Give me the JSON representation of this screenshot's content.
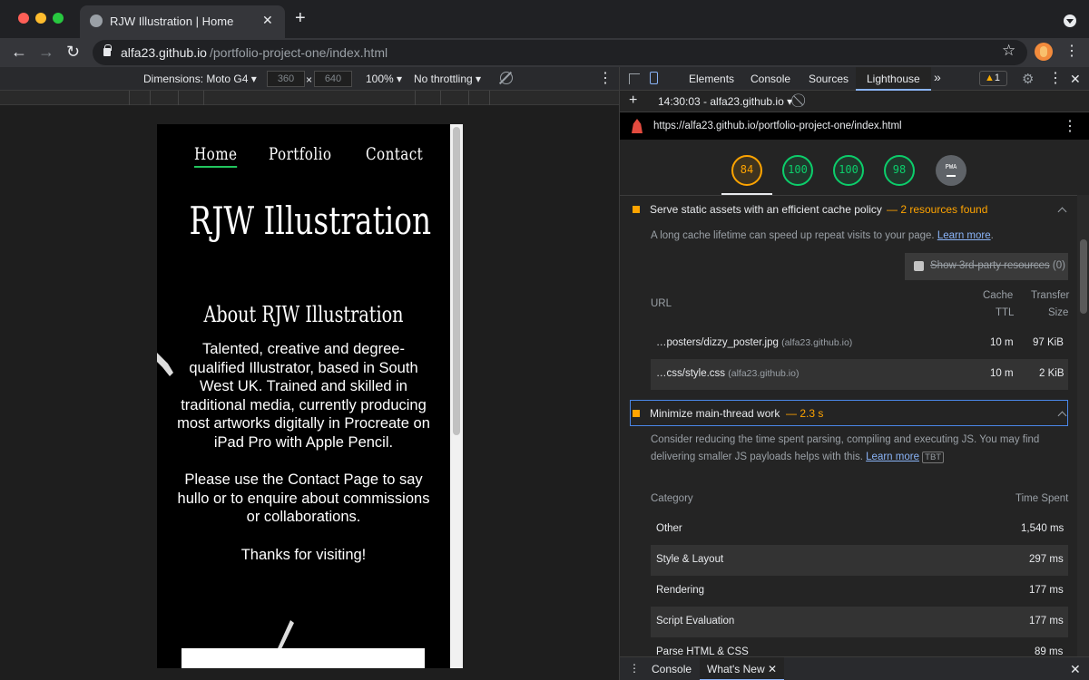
{
  "browser": {
    "tab_title": "RJW Illustration | Home",
    "tab_close": "✕",
    "new_tab": "+",
    "back": "←",
    "forward": "→",
    "reload": "↻",
    "url_host": "alfa23.github.io",
    "url_path": "/portfolio-project-one/index.html",
    "star": "☆",
    "menu": "⋮"
  },
  "device_toolbar": {
    "dimensions_label": "Dimensions: Moto G4 ▾",
    "width": "360",
    "times": "×",
    "height": "640",
    "zoom": "100% ▾",
    "throttling": "No throttling ▾",
    "menu": "⋮"
  },
  "page": {
    "nav": [
      "Home",
      "Portfolio",
      "Contact"
    ],
    "title": "RJW Illustration",
    "about_heading": "About RJW Illustration",
    "paragraph1": "Talented, creative and degree-qualified Illustrator, based in South West UK. Trained and skilled in traditional media, currently producing most artworks digitally in Procreate on iPad Pro with Apple Pencil.",
    "paragraph2": "Please use the Contact Page to say hullo or to enquire about commissions or collaborations.",
    "paragraph3": "Thanks for visiting!"
  },
  "devtools": {
    "tabs": [
      "Elements",
      "Console",
      "Sources",
      "Lighthouse"
    ],
    "more_tabs": "»",
    "warnings": "1",
    "warn_icon": "▲",
    "gear": "⚙",
    "menu": "⋮",
    "close": "✕",
    "add": "+",
    "report_time": "14:30:03 - alfa23.github.io ▾",
    "clear": "⃠",
    "report_url": "https://alfa23.github.io/portfolio-project-one/index.html",
    "scores": [
      {
        "value": "84",
        "status": "average"
      },
      {
        "value": "100",
        "status": "pass"
      },
      {
        "value": "100",
        "status": "pass"
      },
      {
        "value": "98",
        "status": "pass"
      }
    ],
    "pwa_label": "PWA",
    "audit_cache": {
      "title": "Serve static assets with an efficient cache policy",
      "meta": "— 2 resources found",
      "description": "A long cache lifetime can speed up repeat visits to your page.",
      "learn_more": "Learn more",
      "third_party": "Show 3rd-party resources",
      "third_party_count": "(0)",
      "col_url": "URL",
      "col_cache_1": "Cache",
      "col_cache_2": "TTL",
      "col_transfer_1": "Transfer",
      "col_transfer_2": "Size",
      "rows": [
        {
          "url": "…posters/dizzy_poster.jpg",
          "host": "(alfa23.github.io)",
          "ttl": "10 m",
          "size": "97 KiB"
        },
        {
          "url": "…css/style.css",
          "host": "(alfa23.github.io)",
          "ttl": "10 m",
          "size": "2 KiB"
        }
      ]
    },
    "audit_main_thread": {
      "title": "Minimize main-thread work",
      "meta": "— 2.3 s",
      "description_1": "Consider reducing the time spent parsing, compiling and executing JS. You may find",
      "description_2": "delivering smaller JS payloads helps with this.",
      "learn_more": "Learn more",
      "badge": "TBT",
      "col_category": "Category",
      "col_time": "Time Spent",
      "rows": [
        {
          "category": "Other",
          "time": "1,540 ms"
        },
        {
          "category": "Style & Layout",
          "time": "297 ms"
        },
        {
          "category": "Rendering",
          "time": "177 ms"
        },
        {
          "category": "Script Evaluation",
          "time": "177 ms"
        },
        {
          "category": "Parse HTML & CSS",
          "time": "89 ms"
        }
      ]
    },
    "drawer": {
      "menu": "⋮",
      "console": "Console",
      "whats_new": "What's New",
      "tab_close": "✕",
      "close": "✕"
    }
  },
  "colors": {
    "score_pass": "#0cce6b",
    "score_average": "#ffa400",
    "link": "#8ab4f8",
    "nav_underline": "#22c55e"
  }
}
